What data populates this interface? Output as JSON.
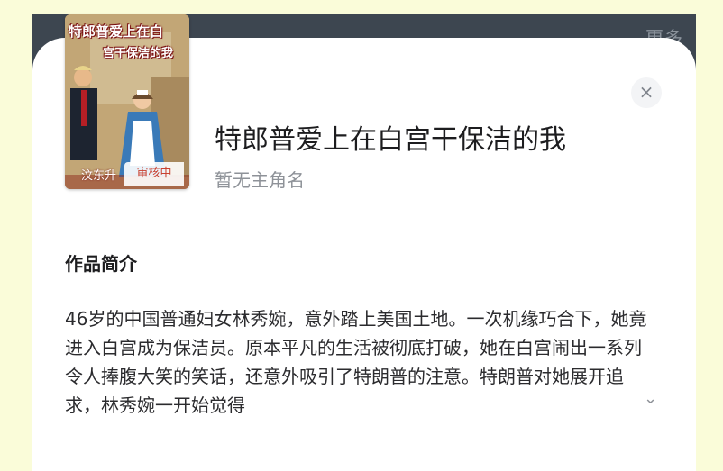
{
  "background": {
    "more_label": "更多"
  },
  "book": {
    "cover": {
      "title_line1": "特郎普爱上在白",
      "title_line2": "宫干保洁的我",
      "author_text": "汶东升",
      "status_badge": "审核中"
    },
    "title": "特郎普爱上在白宫干保洁的我",
    "subtitle": "暂无主角名"
  },
  "close": {
    "icon": "close-icon",
    "label": "×"
  },
  "synopsis": {
    "heading": "作品简介",
    "text": "46岁的中国普通妇女林秀婉，意外踏上美国土地。一次机缘巧合下，她竟进入白宫成为保洁员。原本平凡的生活被彻底打破，她在白宫闹出一系列令人捧腹大笑的笑话，还意外吸引了特朗普的注意。特朗普对她展开追求，林秀婉一开始觉得",
    "expand_icon": "chevron-down-icon",
    "expand_glyph": "⌄"
  },
  "colors": {
    "sheet": "#ffffff",
    "backdrop": "#3d4650",
    "accent_badge": "#c9402f"
  }
}
